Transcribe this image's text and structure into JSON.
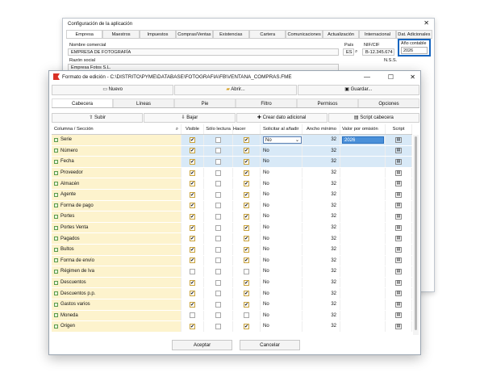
{
  "back_window": {
    "title": "Configuración de la aplicación",
    "tabs": [
      "Empresa",
      "Maestros",
      "Impuestos",
      "Compras/Ventas",
      "Existencias",
      "Cartera",
      "Comunicaciones",
      "Actualización",
      "Internacional",
      "Dat. Adicionales"
    ],
    "labels": {
      "nombre": "Nombre comercial",
      "razon": "Razón social",
      "pais": "País",
      "nif": "NIF/CIF",
      "nss": "N.S.S.",
      "anio": "Año contable"
    },
    "values": {
      "nombre": "EMPRESA DE FOTOGRAFÍA",
      "razon": "Empresa Fotos S.L.",
      "pais": "ES",
      "nif": "B-12.345.674",
      "anio": "2026"
    }
  },
  "window": {
    "title": "Formato de edición - C:\\DISTRITO\\PYME\\DATABASE\\FOTOGRAFIA\\FB\\VENTANA_COMPRAS.FME",
    "toolbar": {
      "nuevo": "Nuevo",
      "abrir": "Abrir...",
      "guardar": "Guardar..."
    },
    "tabs": [
      "Cabecera",
      "Líneas",
      "Pie",
      "Filtro",
      "Permisos",
      "Opciones"
    ],
    "toolbar2": {
      "subir": "Subir",
      "bajar": "Bajar",
      "crear": "Crear dato adicional",
      "script": "Script cabecera"
    },
    "headers": {
      "col": "Columna / Sección",
      "vis": "Visible",
      "sl": "Sólo lectura",
      "hp": "Hacer parada",
      "sol": "Solicitar al añadir",
      "anc": "Ancho mínimo",
      "vpo": "Valor por omisión",
      "scr": "Script"
    },
    "footer": {
      "ok": "Aceptar",
      "cancel": "Cancelar"
    }
  },
  "rows": [
    {
      "name": "Serie",
      "vis": true,
      "sl": false,
      "hp": true,
      "sol": "No",
      "anc": "32",
      "vpo": "2026",
      "sel": true
    },
    {
      "name": "Número",
      "vis": true,
      "sl": false,
      "hp": true,
      "sol": "No",
      "anc": "32",
      "vpo": "",
      "sel": true
    },
    {
      "name": "Fecha",
      "vis": true,
      "sl": false,
      "hp": true,
      "sol": "No",
      "anc": "32",
      "vpo": "",
      "sel": true
    },
    {
      "name": "Proveedor",
      "vis": true,
      "sl": false,
      "hp": true,
      "sol": "No",
      "anc": "32",
      "vpo": ""
    },
    {
      "name": "Almacén",
      "vis": true,
      "sl": false,
      "hp": true,
      "sol": "No",
      "anc": "32",
      "vpo": ""
    },
    {
      "name": "Agente",
      "vis": true,
      "sl": false,
      "hp": true,
      "sol": "No",
      "anc": "32",
      "vpo": ""
    },
    {
      "name": "Forma de pago",
      "vis": true,
      "sl": false,
      "hp": true,
      "sol": "No",
      "anc": "32",
      "vpo": ""
    },
    {
      "name": "Portes",
      "vis": true,
      "sl": false,
      "hp": true,
      "sol": "No",
      "anc": "32",
      "vpo": ""
    },
    {
      "name": "Portes Venta",
      "vis": true,
      "sl": false,
      "hp": true,
      "sol": "No",
      "anc": "32",
      "vpo": ""
    },
    {
      "name": "Pagados",
      "vis": true,
      "sl": false,
      "hp": true,
      "sol": "No",
      "anc": "32",
      "vpo": ""
    },
    {
      "name": "Bultos",
      "vis": true,
      "sl": false,
      "hp": true,
      "sol": "No",
      "anc": "32",
      "vpo": ""
    },
    {
      "name": "Forma de envío",
      "vis": true,
      "sl": false,
      "hp": true,
      "sol": "No",
      "anc": "32",
      "vpo": ""
    },
    {
      "name": "Régimen de Iva",
      "vis": false,
      "sl": false,
      "hp": false,
      "sol": "No",
      "anc": "32",
      "vpo": ""
    },
    {
      "name": "Descuentos",
      "vis": true,
      "sl": false,
      "hp": true,
      "sol": "No",
      "anc": "32",
      "vpo": ""
    },
    {
      "name": "Descuentos p.p.",
      "vis": true,
      "sl": false,
      "hp": true,
      "sol": "No",
      "anc": "32",
      "vpo": ""
    },
    {
      "name": "Gastos varios",
      "vis": true,
      "sl": false,
      "hp": true,
      "sol": "No",
      "anc": "32",
      "vpo": ""
    },
    {
      "name": "Moneda",
      "vis": false,
      "sl": false,
      "hp": false,
      "sol": "No",
      "anc": "32",
      "vpo": ""
    },
    {
      "name": "Origen",
      "vis": true,
      "sl": false,
      "hp": true,
      "sol": "No",
      "anc": "32",
      "vpo": ""
    }
  ]
}
